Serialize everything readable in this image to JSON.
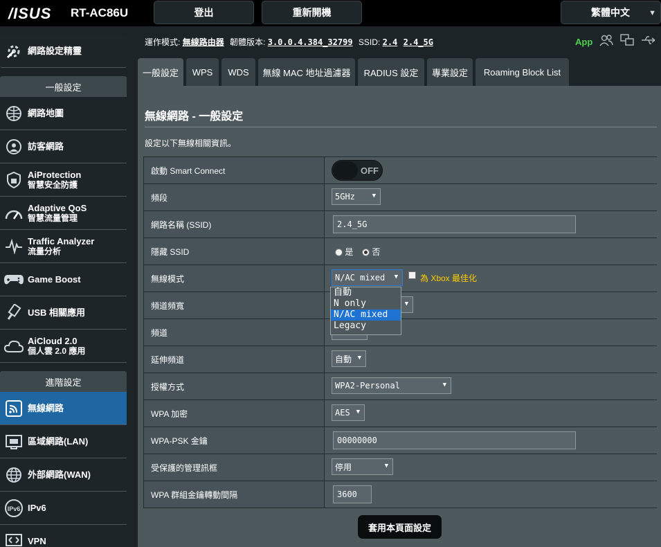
{
  "header": {
    "logo": "/ISUS",
    "model": "RT-AC86U",
    "logout": "登出",
    "reboot": "重新開機",
    "language": "繁體中文"
  },
  "sidebar": {
    "quick_setup": "網路設定精靈",
    "general_section": "一般設定",
    "general": [
      {
        "label": "網路地圖",
        "sub": "",
        "icon": "globe-map-icon"
      },
      {
        "label": "訪客網路",
        "sub": "",
        "icon": "guest-network-icon"
      },
      {
        "label": "AiProtection",
        "sub": "智慧安全防護",
        "icon": "shield-lock-icon"
      },
      {
        "label": "Adaptive QoS",
        "sub": "智慧流量管理",
        "icon": "speedometer-icon"
      },
      {
        "label": "Traffic Analyzer",
        "sub": "流量分析",
        "icon": "pulse-icon"
      },
      {
        "label": "Game Boost",
        "sub": "",
        "icon": "gamepad-icon"
      },
      {
        "label": "USB 相關應用",
        "sub": "",
        "icon": "usb-icon"
      },
      {
        "label": "AiCloud 2.0",
        "sub": "個人雲 2.0 應用",
        "icon": "cloud-icon"
      }
    ],
    "advanced_section": "進階設定",
    "advanced": [
      {
        "label": "無線網路",
        "icon": "wifi-icon"
      },
      {
        "label": "區域網路(LAN)",
        "icon": "lan-icon"
      },
      {
        "label": "外部網路(WAN)",
        "icon": "wan-globe-icon"
      },
      {
        "label": "IPv6",
        "icon": "ipv6-icon"
      },
      {
        "label": "VPN",
        "icon": "vpn-icon"
      }
    ]
  },
  "status": {
    "mode_label": "運作模式:",
    "mode_value": "無線路由器",
    "fw_label": "韌體版本:",
    "fw_value": "3.0.0.4.384_32799",
    "ssid_label": "SSID:",
    "ssid_1": "2.4",
    "ssid_2": "2.4_5G",
    "app": "App"
  },
  "tabs": [
    "一般設定",
    "WPS",
    "WDS",
    "無線 MAC 地址過濾器",
    "RADIUS 設定",
    "專業設定",
    "Roaming Block List"
  ],
  "content": {
    "title": "無線網路 - 一般設定",
    "desc": "設定以下無線相關資訊。",
    "smart_connect": {
      "label": "啟動 Smart Connect",
      "value": "OFF"
    },
    "band": {
      "label": "頻段",
      "value": "5GHz"
    },
    "ssid": {
      "label": "網路名稱 (SSID)",
      "value": "2.4_5G"
    },
    "hide_ssid": {
      "label": "隱藏 SSID",
      "yes": "是",
      "no": "否"
    },
    "wireless_mode": {
      "label": "無線模式",
      "value": "N/AC mixed",
      "xbox": "為 Xbox 最佳化",
      "options": [
        "自動",
        "N only",
        "N/AC mixed",
        "Legacy"
      ]
    },
    "bandwidth": {
      "label": "頻道頻寬"
    },
    "channel": {
      "label": "頻道"
    },
    "ext_channel": {
      "label": "延伸頻道",
      "value": "自動"
    },
    "auth": {
      "label": "授權方式",
      "value": "WPA2-Personal"
    },
    "wpa_enc": {
      "label": "WPA 加密",
      "value": "AES"
    },
    "psk": {
      "label": "WPA-PSK 金鑰",
      "value": "00000000"
    },
    "pmf": {
      "label": "受保護的管理訊框",
      "value": "停用"
    },
    "rekey": {
      "label": "WPA 群組金鑰轉動間隔",
      "value": "3600"
    },
    "apply": "套用本頁面設定"
  }
}
